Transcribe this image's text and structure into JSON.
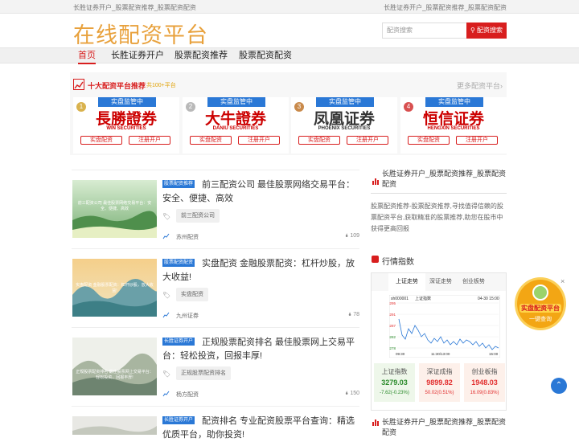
{
  "topbar": {
    "left": "长胜证券开户_股票配资推荐_股票配资配资",
    "right": "长胜证券开户_股票配资推荐_股票配资配资"
  },
  "header": {
    "logo": "在线配资平台",
    "search_placeholder": "配资搜索",
    "search_button": "配资搜索"
  },
  "nav": {
    "items": [
      "首页",
      "长胜证券开户",
      "股票配资推荐",
      "股票配资配资"
    ]
  },
  "promo": {
    "title": "十大配资平台推荐",
    "sub": "共100+平台",
    "more": "更多配资平台",
    "cards": [
      {
        "rank": "1",
        "tag": "实盘监管中",
        "brand": "長勝證券",
        "en": "WIN SECURITIES",
        "b1": "实盘配资",
        "b2": "注册开户",
        "color": "#c00"
      },
      {
        "rank": "2",
        "tag": "实盘监管中",
        "brand": "大牛證券",
        "en": "DANIU SECURITIES",
        "b1": "实盘配资",
        "b2": "注册开户",
        "color": "#c00"
      },
      {
        "rank": "3",
        "tag": "实盘监管中",
        "brand": "凤凰证券",
        "en": "PHOENIX SECURITIES",
        "b1": "实盘配资",
        "b2": "注册开户",
        "color": "#333"
      },
      {
        "rank": "4",
        "tag": "实盘监管中",
        "brand": "恒信证券",
        "en": "HENGXIN SECURITIES",
        "b1": "实盘配资",
        "b2": "注册开户",
        "color": "#c00"
      }
    ]
  },
  "articles": [
    {
      "category": "股票配资推荐",
      "title": "前三配资公司 最佳股票网络交易平台：安全、便捷、高效",
      "keyword": "前三配资公司",
      "source": "苏州配资",
      "views": "109",
      "thumb_text": "前三配资公司 最佳股票网络交易平台：安全、便捷、高效"
    },
    {
      "category": "股票配资配资",
      "title": "实盘配资 金融股票配资：杠杆炒股，放大收益!",
      "keyword": "实盘配资",
      "source": "九州证券",
      "views": "78",
      "thumb_text": "实盘配资 金融股票配资：杠杆炒股，放大收益!"
    },
    {
      "category": "长胜证券开户",
      "title": "正规股票配资排名 最佳股票网上交易平台：轻松投资，回报丰厚!",
      "keyword": "正规股票配资排名",
      "source": "杨方配资",
      "views": "150",
      "thumb_text": "正规股票配资排名 最佳股票网上交易平台：轻松投资，回报丰厚!"
    },
    {
      "category": "长胜证券开户",
      "title": "配资排名 专业配资股票平台查询：精选优质平台，助你投资!",
      "keyword": "",
      "source": "",
      "views": "",
      "thumb_text": ""
    }
  ],
  "side1": {
    "title": "长胜证券开户_股票配资推荐_股票配资配资",
    "desc": "股票配资推荐-股票配资推荐,寻找值得信赖的股票配资平台,获取精准的股票推荐,助您在股市中获得更高回报"
  },
  "market": {
    "title": "行情指数",
    "tabs": [
      "上证走势",
      "深证走势",
      "创业板势"
    ],
    "mini_chart": {
      "code": "sh000001",
      "name": "上证指数",
      "date": "04-30 15:00",
      "y_ticks": [
        "3295",
        "3291",
        "3287",
        "3282",
        "3278"
      ],
      "x_ticks": [
        "09:30",
        "11:30/13:00",
        "15:00"
      ]
    },
    "quotes": [
      {
        "name": "上证指数",
        "value": "3279.03",
        "change": "-7.62(-0.23%)",
        "dir": "down"
      },
      {
        "name": "深证成指",
        "value": "9899.82",
        "change": "50.02(0.51%)",
        "dir": "up"
      },
      {
        "name": "创业板指",
        "value": "1948.03",
        "change": "16.09(0.83%)",
        "dir": "up"
      }
    ]
  },
  "side3": {
    "title": "长胜证券开户_股票配资推荐_股票配资配资"
  },
  "float_ad": {
    "line1": "实盘配资平台",
    "line2": "一键查询",
    "close": "×"
  },
  "scroll_top": "⌃"
}
